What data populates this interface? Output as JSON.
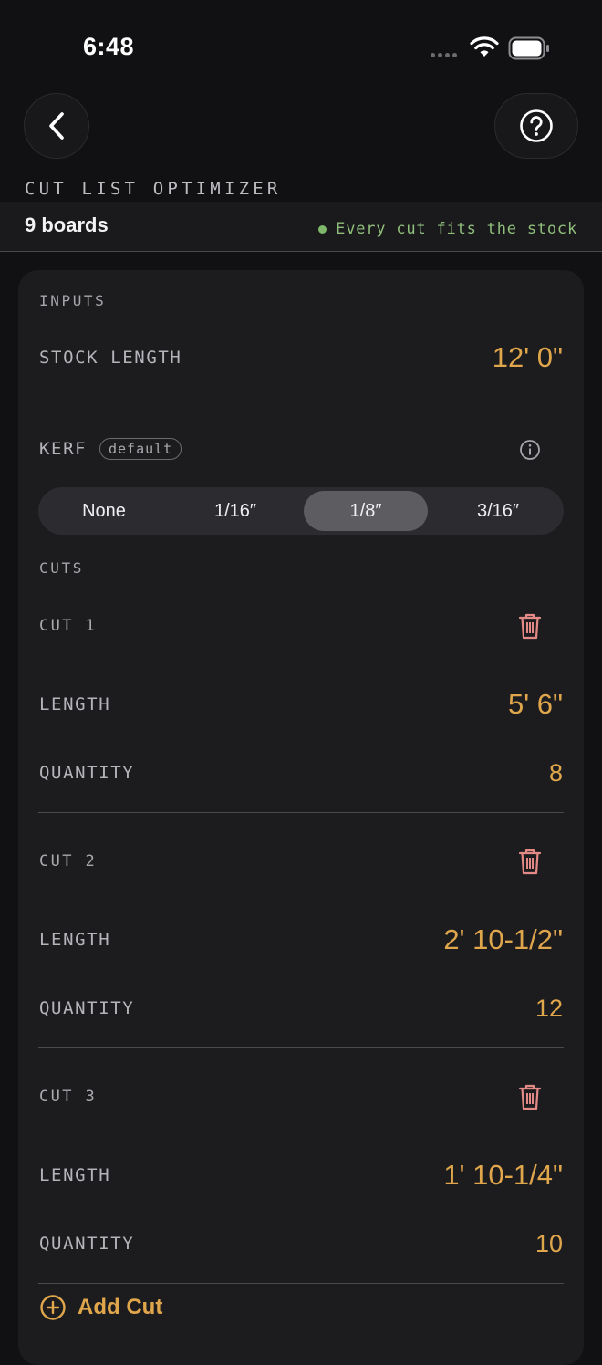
{
  "status_bar": {
    "time": "6:48"
  },
  "header": {
    "app_title": "CUT LIST OPTIMIZER"
  },
  "summary": {
    "boards": "9 boards",
    "fit_status": "Every cut fits the stock"
  },
  "inputs": {
    "section_label": "INPUTS",
    "stock_length_label": "STOCK LENGTH",
    "stock_length_value": "12' 0\"",
    "kerf_label": "KERF",
    "kerf_badge": "default",
    "kerf_options": [
      "None",
      "1/16″",
      "1/8″",
      "3/16″"
    ],
    "kerf_selected": "1/8″"
  },
  "cuts": {
    "section_label": "CUTS",
    "length_label": "LENGTH",
    "quantity_label": "QUANTITY",
    "items": [
      {
        "label": "CUT 1",
        "length": "5' 6\"",
        "quantity": "8"
      },
      {
        "label": "CUT 2",
        "length": "2' 10-1/2\"",
        "quantity": "12"
      },
      {
        "label": "CUT 3",
        "length": "1' 10-1/4\"",
        "quantity": "10"
      }
    ],
    "add_label": "Add Cut"
  },
  "colors": {
    "accent": "#e0a64c",
    "success": "#7fb86a",
    "danger": "#e38a86",
    "background": "#111113",
    "card": "#1c1c1f"
  }
}
